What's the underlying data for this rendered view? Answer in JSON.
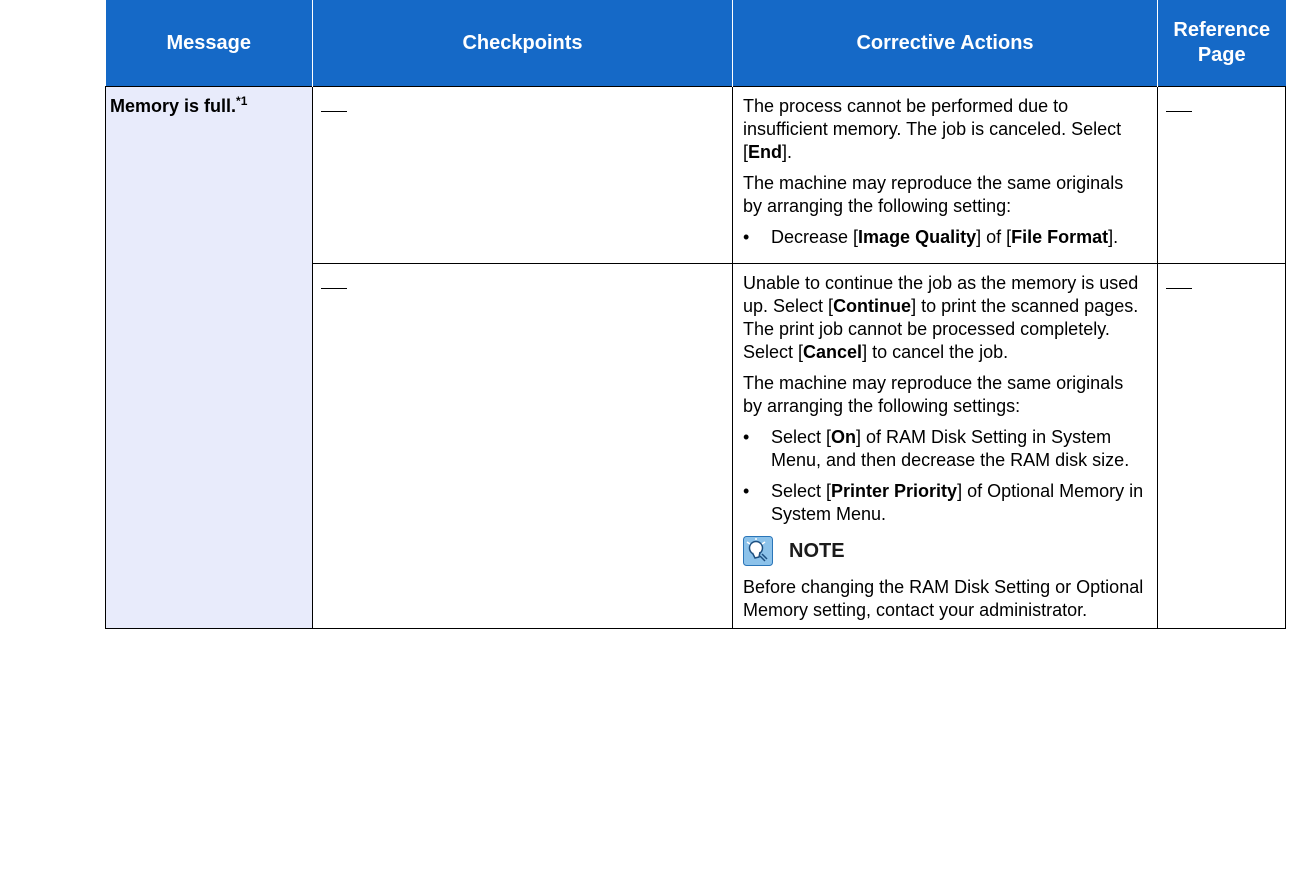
{
  "headers": {
    "message": "Message",
    "checkpoints": "Checkpoints",
    "corrective": "Corrective Actions",
    "reference_line1": "Reference",
    "reference_line2": "Page"
  },
  "message_label": "Memory is full.",
  "message_footnote": "*1",
  "row1": {
    "checkpoint": "",
    "p1_a": "The process cannot be performed due to insufficient memory. The job is canceled. Select [",
    "p1_b": "End",
    "p1_c": "].",
    "p2": "The machine may reproduce the same originals by arranging the following setting:",
    "bullet_dot": "•",
    "b1_a": "Decrease [",
    "b1_b": "Image Quality",
    "b1_c": "] of [",
    "b1_d": "File Format",
    "b1_e": "]."
  },
  "row2": {
    "p1_a": "Unable to continue the job as the memory is used up. Select [",
    "p1_b": "Continue",
    "p1_c": "] to print the scanned pages. The print job cannot be processed completely. Select [",
    "p1_d": "Cancel",
    "p1_e": "] to cancel the job.",
    "p2": "The machine may reproduce the same originals by arranging the following settings:",
    "bullet_dot": "•",
    "b1_a": "Select [",
    "b1_b": "On",
    "b1_c": "] of RAM Disk Setting in System Menu, and then decrease the RAM disk size.",
    "b2_a": "Select [",
    "b2_b": "Printer Priority",
    "b2_c": "] of Optional Memory in System Menu.",
    "note_label": "NOTE",
    "note_text": "Before changing the RAM Disk Setting or Optional Memory setting, contact your administrator."
  },
  "icons": {
    "note": "note-lightbulb-icon",
    "dash": "em-dash"
  },
  "colors": {
    "header_bg": "#1569c7",
    "message_bg": "#e8ebfb"
  }
}
